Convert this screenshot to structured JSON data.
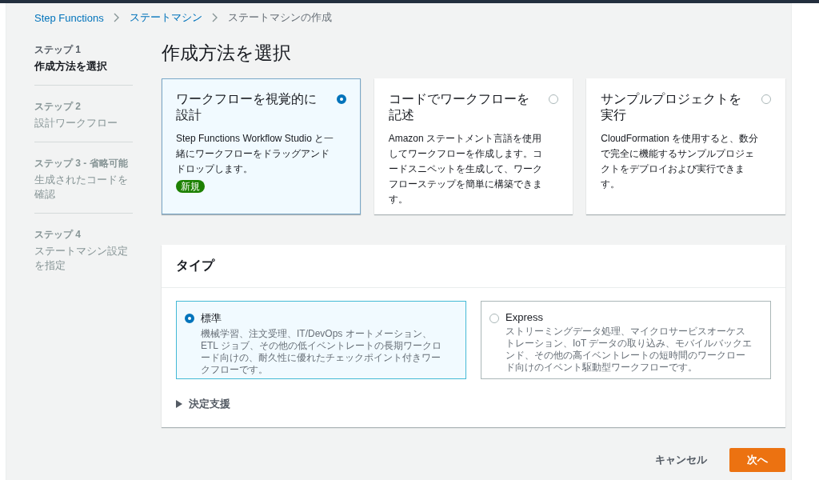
{
  "breadcrumb": [
    {
      "label": "Step Functions",
      "link": true
    },
    {
      "label": "ステートマシン",
      "link": true
    },
    {
      "label": "ステートマシンの作成",
      "link": false
    }
  ],
  "steps": [
    {
      "step": "ステップ 1",
      "title": "作成方法を選択",
      "selected": true
    },
    {
      "step": "ステップ 2",
      "title": "設計ワークフロー",
      "selected": false
    },
    {
      "step": "ステップ 3 - 省略可能",
      "title": "生成されたコードを確認",
      "selected": false
    },
    {
      "step": "ステップ 4",
      "title": "ステートマシン設定を指定",
      "selected": false
    }
  ],
  "page_title": "作成方法を選択",
  "methods": [
    {
      "title": "ワークフローを視覚的に設計",
      "description": "Step Functions Workflow Studio と一緒にワークフローをドラッグアンドドロップします。",
      "badge": "新規",
      "selected": true
    },
    {
      "title": "コードでワークフローを記述",
      "description": "Amazon ステートメント言語を使用してワークフローを作成します。コードスニペットを生成して、ワークフローステップを簡単に構築できます。",
      "selected": false
    },
    {
      "title": "サンプルプロジェクトを実行",
      "description": "CloudFormation を使用すると、数分で完全に機能するサンプルプロジェクトをデプロイおよび実行できます。",
      "selected": false
    }
  ],
  "type_panel": {
    "title": "タイプ",
    "options": [
      {
        "label": "標準",
        "description": "機械学習、注文受理、IT/DevOps オートメーション、ETL ジョブ、その他の低イベントレートの長期ワークロード向けの、耐久性に優れたチェックポイント付きワークフローです。",
        "selected": true
      },
      {
        "label": "Express",
        "description": "ストリーミングデータ処理、マイクロサービスオーケストレーション、IoT データの取り込み、モバイルバックエンド、その他の高イベントレートの短時間のワークロード向けのイベント駆動型ワークフローです。",
        "selected": false
      }
    ],
    "decision_help": {
      "label": "決定支援",
      "expanded": false
    }
  },
  "buttons": {
    "cancel": "キャンセル",
    "next": "次へ"
  }
}
